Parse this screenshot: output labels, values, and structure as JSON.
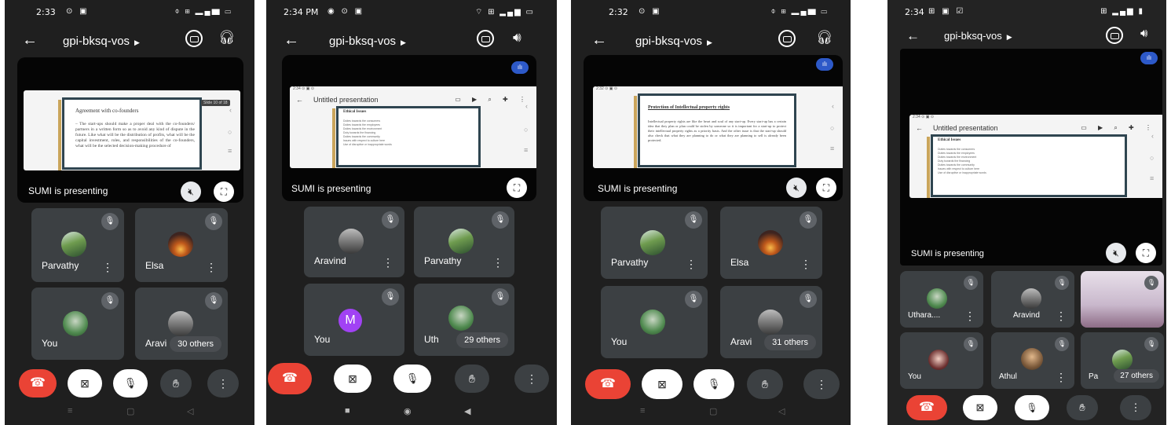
{
  "colors": {
    "end_call": "#ea4335",
    "tile_bg": "#3c4043",
    "screen_bg": "#1f1f1f",
    "speaking_pill": "#2d59c8",
    "avatar_letter_bg": "#a142f4"
  },
  "meeting": {
    "code": "gpi-bksq-vos",
    "presenting_label": "SUMI is presenting",
    "slide_app_title": "Untitled presentation"
  },
  "phones": [
    {
      "status_time": "2:33",
      "slide_title": "Agreement with co-founders",
      "slide_body": "– The start-ups should make a proper deal with the co-founders/ partners in a written form so as to avoid any kind of dispute in the future. Like what will be the distribution of profits, what will be the capital investment, roles, and responsibilities of the co-founders, what will be the selected decision-making procedure of",
      "slide_badge": "Slide 10 of 18",
      "tiles": [
        "Parvathy",
        "Elsa",
        "You",
        "Aravi"
      ],
      "others": "30 others"
    },
    {
      "status_time": "2:34 PM",
      "slide_heading": "Ethical Issues",
      "slide_lines": [
        "Duties towards the consumers",
        "Duties towards the employees",
        "Duties towards the environment",
        "Duty towards the financing",
        "Duties towards the community",
        "Issues with respect to culture here",
        "Use of disruptive or inappropriate words"
      ],
      "tiles": [
        "Aravind",
        "Parvathy",
        "You",
        "Uth"
      ],
      "avatar_letter": "M",
      "others": "29 others"
    },
    {
      "status_time": "2:32",
      "slide_title": "Protection of Intellectual property rights",
      "slide_body": "Intellectual property rights are like the heart and soul of any start-up. Every start-up has a certain idea that they plan or plan could be stolen by someone so it is important for a start-up to protect their intellectual property rights as a priority basis. And the other issue is that the start-up should also check that what they are planning to do or what they are planning to sell is already been protected.",
      "tiles": [
        "Parvathy",
        "Elsa",
        "You",
        "Aravi"
      ],
      "others": "31 others"
    },
    {
      "status_time": "2:34",
      "slide_heading": "Ethical Issues",
      "slide_lines": [
        "Duties towards the consumers",
        "Duties towards the employees",
        "Duties towards the environment",
        "Duty towards the financing",
        "Duties towards the community",
        "Issues with respect to culture here",
        "Use of disruptive or inappropriate words"
      ],
      "tiles": [
        "Uthara....",
        "Aravind",
        "",
        "You",
        "Athul",
        "Pa"
      ],
      "others": "27 others"
    }
  ]
}
